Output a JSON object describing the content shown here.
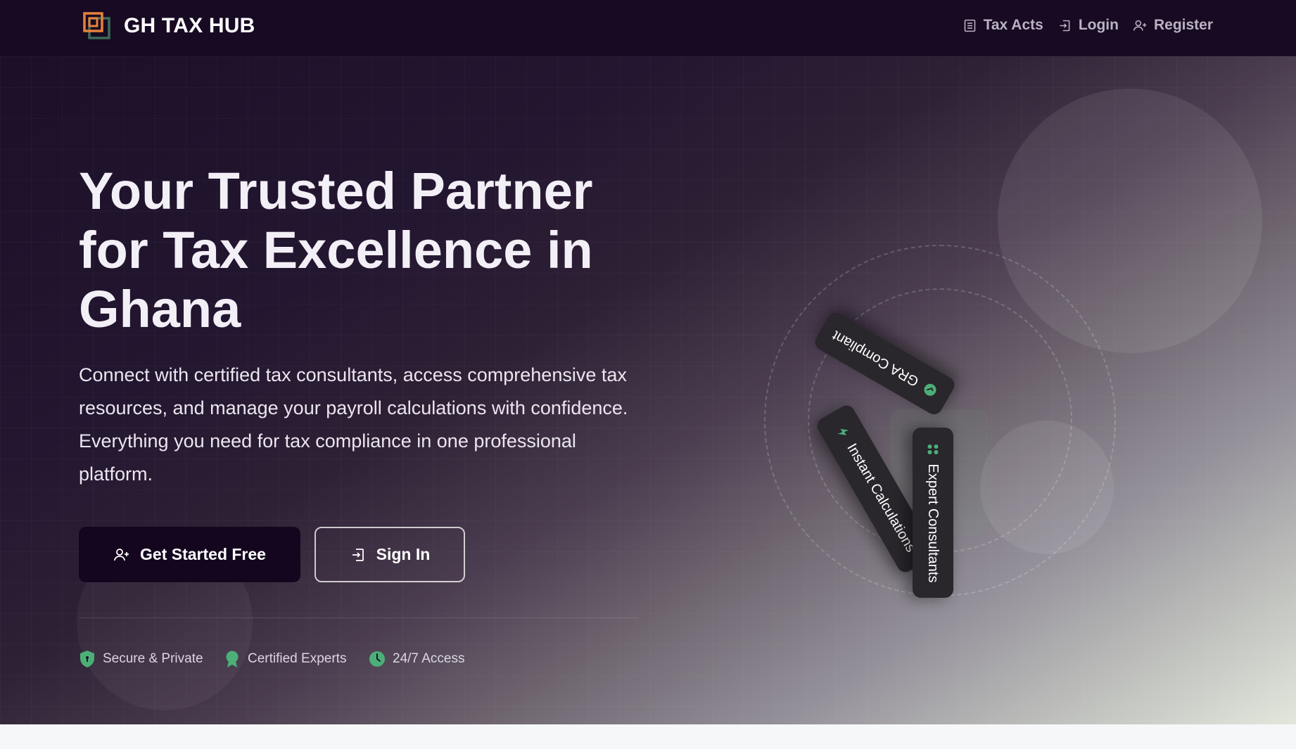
{
  "navbar": {
    "brand_name": "GH TAX HUB",
    "links": [
      {
        "label": "Tax Acts",
        "icon": "document-icon"
      },
      {
        "label": "Login",
        "icon": "login-icon"
      },
      {
        "label": "Register",
        "icon": "user-plus-icon"
      }
    ]
  },
  "hero": {
    "title": "Your Trusted Partner for Tax Excellence in Ghana",
    "description": "Connect with certified tax consultants, access comprehensive tax resources, and manage your payroll calculations with confidence. Everything you need for tax compliance in one professional platform.",
    "primary_button": "Get Started Free",
    "secondary_button": "Sign In",
    "trust_badges": [
      {
        "label": "Secure & Private",
        "icon": "shield-check-icon"
      },
      {
        "label": "Certified Experts",
        "icon": "award-icon"
      },
      {
        "label": "24/7 Access",
        "icon": "clock-icon"
      }
    ]
  },
  "visual": {
    "pills": [
      {
        "label": "GRA Compliant",
        "icon": "check-circle-icon"
      },
      {
        "label": "Instant Calculations",
        "icon": "lightning-icon"
      },
      {
        "label": "Expert Consultants",
        "icon": "users-icon"
      }
    ]
  },
  "colors": {
    "navbar_bg": "#170a22",
    "primary_button_bg": "#14061f",
    "accent_green": "#4caf78",
    "logo_orange": "#e8813a",
    "logo_green": "#3d6b5a"
  }
}
